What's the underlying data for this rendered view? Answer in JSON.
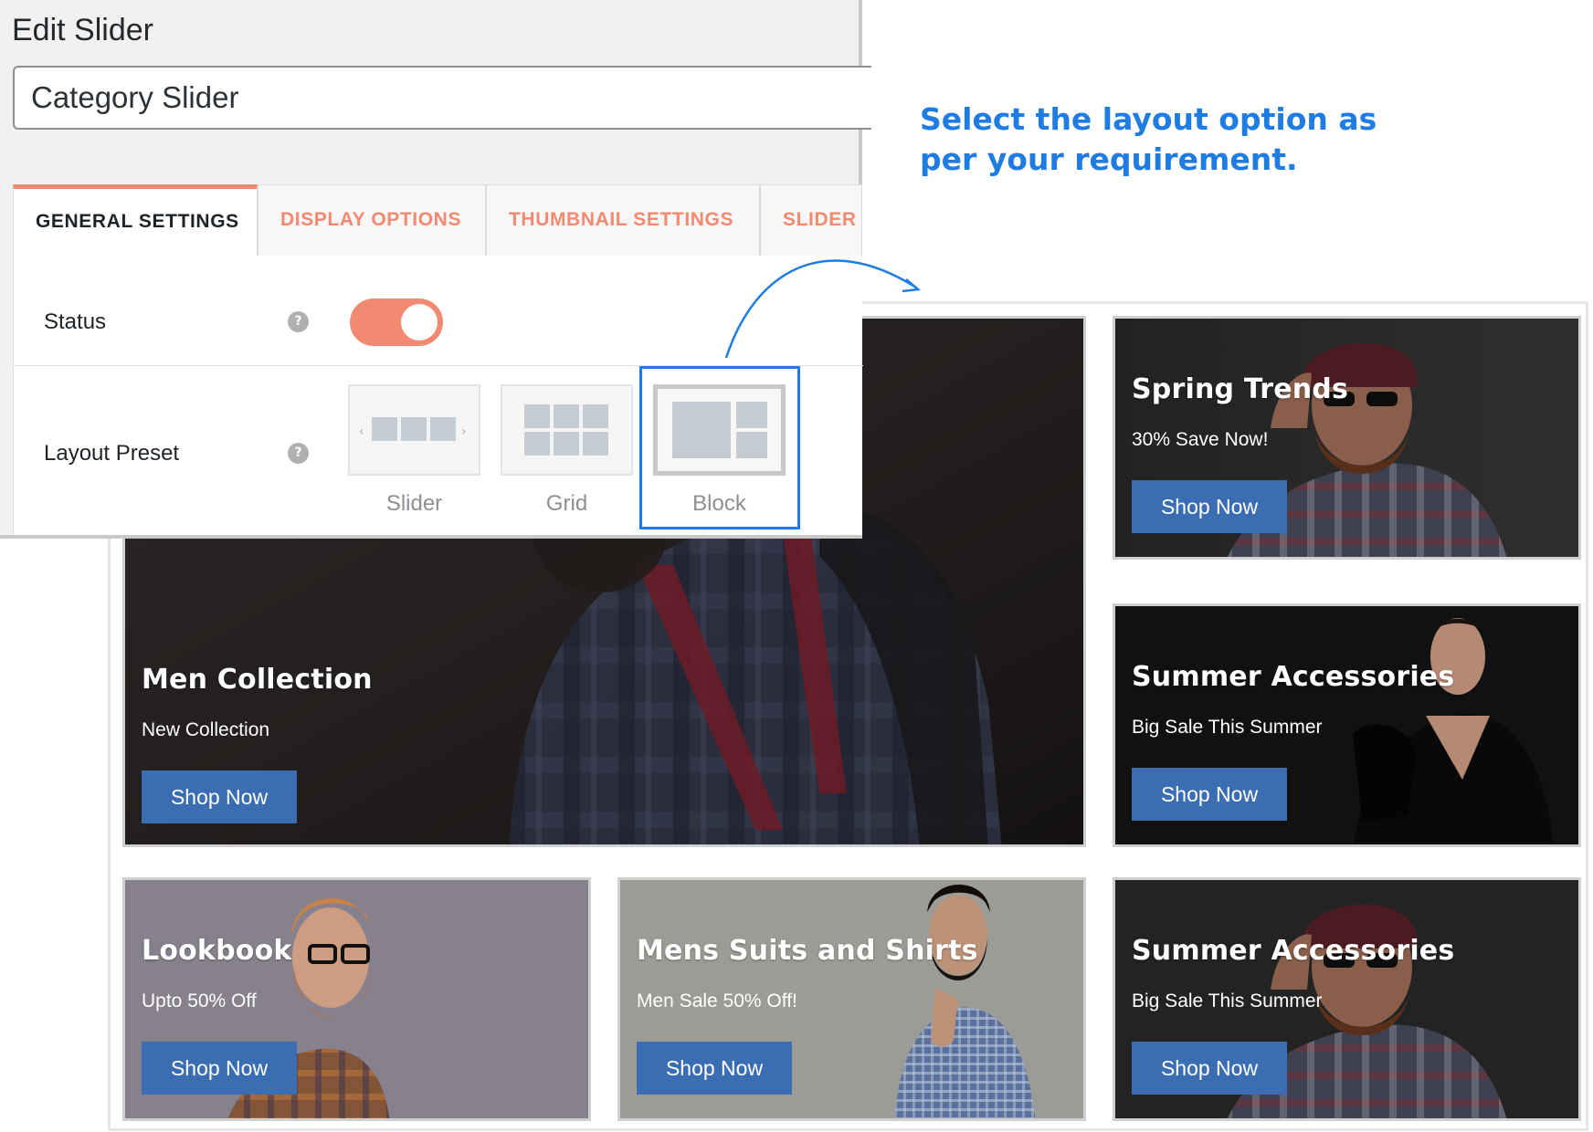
{
  "panel": {
    "title": "Edit Slider",
    "slider_name": "Category Slider",
    "tabs": [
      {
        "label": "GENERAL SETTINGS",
        "active": true
      },
      {
        "label": "DISPLAY OPTIONS",
        "active": false
      },
      {
        "label": "THUMBNAIL SETTINGS",
        "active": false
      },
      {
        "label": "SLIDER",
        "active": false
      }
    ],
    "status": {
      "label": "Status",
      "enabled": true
    },
    "layout_preset": {
      "label": "Layout Preset",
      "options": [
        {
          "label": "Slider",
          "selected": false
        },
        {
          "label": "Grid",
          "selected": false
        },
        {
          "label": "Block",
          "selected": true
        }
      ]
    },
    "help_glyph": "?"
  },
  "annotation": {
    "text": "Select the layout option as per your requirement."
  },
  "preview": {
    "cards": [
      {
        "title": "Men Collection",
        "subtitle": "New Collection",
        "button": "Shop Now"
      },
      {
        "title": "Spring Trends",
        "subtitle": "30% Save Now!",
        "button": "Shop Now"
      },
      {
        "title": "Summer Accessories",
        "subtitle": "Big Sale This Summer",
        "button": "Shop Now"
      },
      {
        "title": "Lookbook",
        "subtitle": "Upto 50% Off",
        "button": "Shop Now"
      },
      {
        "title": "Mens Suits and Shirts",
        "subtitle": "Men Sale 50% Off!",
        "button": "Shop Now"
      },
      {
        "title": "Summer Accessories",
        "subtitle": "Big Sale This Summer",
        "button": "Shop Now"
      }
    ]
  },
  "colors": {
    "accent": "#f28a72",
    "button": "#3b6db3",
    "annotation": "#1e7ce2"
  }
}
